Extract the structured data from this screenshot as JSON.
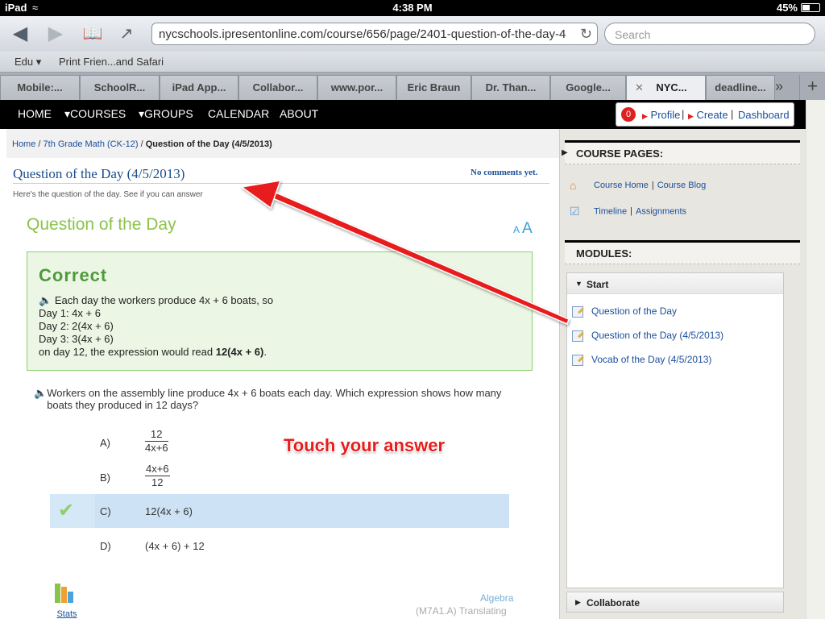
{
  "status": {
    "device": "iPad",
    "time": "4:38 PM",
    "battery": "45%"
  },
  "toolbar": {
    "url": "nycschools.ipresentonline.com/course/656/page/2401-question-of-the-day-4",
    "search_placeholder": "Search"
  },
  "bookmarks": [
    "Edu ▾",
    "Print Frien...and Safari"
  ],
  "tabs": [
    "Mobile:...",
    "SchoolR...",
    "iPad App...",
    "Collabor...",
    "www.por...",
    "Eric Braun",
    "Dr. Than...",
    "Google...",
    "NYC...",
    "deadline..."
  ],
  "nav": {
    "items": [
      "HOME",
      "▾COURSES",
      "▾GROUPS",
      "CALENDAR",
      "ABOUT"
    ],
    "notifications": "0",
    "profile": "Profile",
    "create": "Create",
    "dashboard": "Dashboard"
  },
  "breadcrumb": {
    "home": "Home",
    "course": "7th Grade Math (CK-12)",
    "current": "Question of the Day (4/5/2013)"
  },
  "page": {
    "title": "Question of the Day (4/5/2013)",
    "comments": "No comments yet.",
    "intro": "Here's the question of the day. See if you can answer"
  },
  "question": {
    "heading": "Question of the Day",
    "size_small": "A",
    "size_large": "A",
    "correct_title": "Correct",
    "explanation": [
      "Each day the workers produce 4x + 6 boats, so",
      "Day 1: 4x + 6",
      "Day 2: 2(4x + 6)",
      "Day 3: 3(4x + 6)",
      "on day 12, the expression would read"
    ],
    "explanation_bold": "12(4x + 6)",
    "explanation_end": ".",
    "prompt": "Workers on the assembly line produce 4x + 6 boats each day. Which expression shows how many boats they produced in 12 days?",
    "answers": [
      {
        "letter": "A)",
        "num": "12",
        "den": "4x+6"
      },
      {
        "letter": "B)",
        "num": "4x+6",
        "den": "12"
      },
      {
        "letter": "C)",
        "value": "12(4x + 6)",
        "selected": true
      },
      {
        "letter": "D)",
        "value": "(4x + 6) + 12"
      }
    ],
    "annotation": "Touch your answer",
    "stats_label": "Stats",
    "category": "Algebra",
    "standard": "(M7A1.A) Translating"
  },
  "sidebar": {
    "course_pages_title": "COURSE PAGES:",
    "course_home": "Course Home",
    "course_blog": "Course Blog",
    "timeline": "Timeline",
    "assignments": "Assignments",
    "modules_title": "MODULES:",
    "start": "Start",
    "module_items": [
      "Question of the Day",
      "Question of the Day (4/5/2013)",
      "Vocab of the Day (4/5/2013)"
    ],
    "collaborate": "Collaborate"
  },
  "colors": {
    "accent_green": "#8bc34a",
    "link_blue": "#1a4e9c",
    "annotation_red": "#e81d1d"
  }
}
